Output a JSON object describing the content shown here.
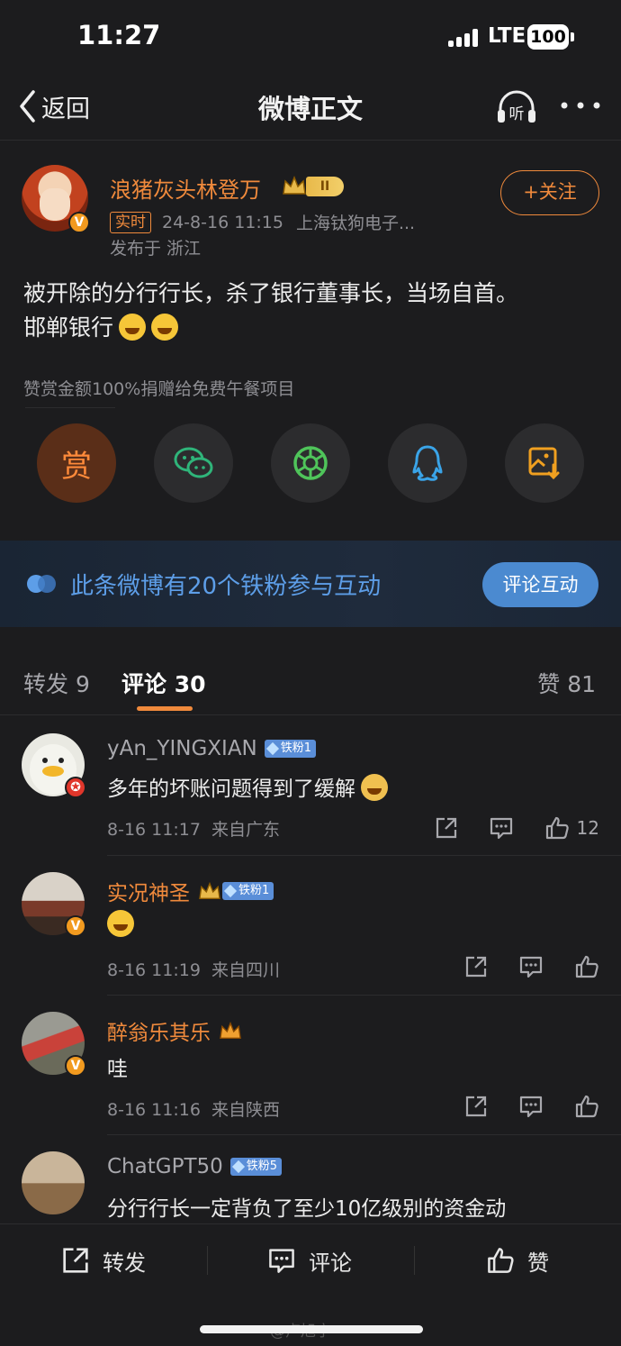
{
  "status": {
    "time": "11:27",
    "network": "LTE",
    "battery": "100"
  },
  "nav": {
    "back_label": "返回",
    "title": "微博正文",
    "listen_label": "听"
  },
  "post": {
    "author": "浪猪灰头林登万",
    "level": "II",
    "realtime_tag": "实时",
    "datetime": "24-8-16 11:15",
    "source": "上海钛狗电子...",
    "location": "发布于 浙江",
    "follow_label": "+关注",
    "text_line1": "被开除的分行行长，杀了银行董事长，当场自首。",
    "text_line2": "邯郸银行",
    "reward_note": "赞赏金额100%捐赠给免费午餐项目",
    "reward_label": "赏"
  },
  "banner": {
    "text": "此条微博有20个铁粉参与互动",
    "button": "评论互动"
  },
  "tabs": {
    "repost_label": "转发",
    "repost_count": "9",
    "comment_label": "评论",
    "comment_count": "30",
    "like_label": "赞",
    "like_count": "81"
  },
  "comments": [
    {
      "name": "yAn_YINGXIAN",
      "badge": "铁粉1",
      "text": "多年的坏账问题得到了缓解",
      "time": "8-16 11:17",
      "from": "来自广东",
      "likes": "12"
    },
    {
      "name": "实况神圣",
      "badge": "铁粉1",
      "text": "",
      "time": "8-16 11:19",
      "from": "来自四川",
      "likes": ""
    },
    {
      "name": "醉翁乐其乐",
      "badge": "",
      "text": "哇",
      "time": "8-16 11:16",
      "from": "来自陕西",
      "likes": ""
    },
    {
      "name": "ChatGPT50",
      "badge": "铁粉5",
      "text": "分行行长一定背负了至少10亿级别的资金动",
      "time": "",
      "from": "",
      "likes": ""
    }
  ],
  "bottom_bar": {
    "repost": "转发",
    "comment": "评论",
    "like": "赞"
  },
  "watermark": "@卢旭宁",
  "colors": {
    "accent": "#f08a3c",
    "link_blue": "#5d9ee8",
    "background": "#1c1c1e"
  }
}
